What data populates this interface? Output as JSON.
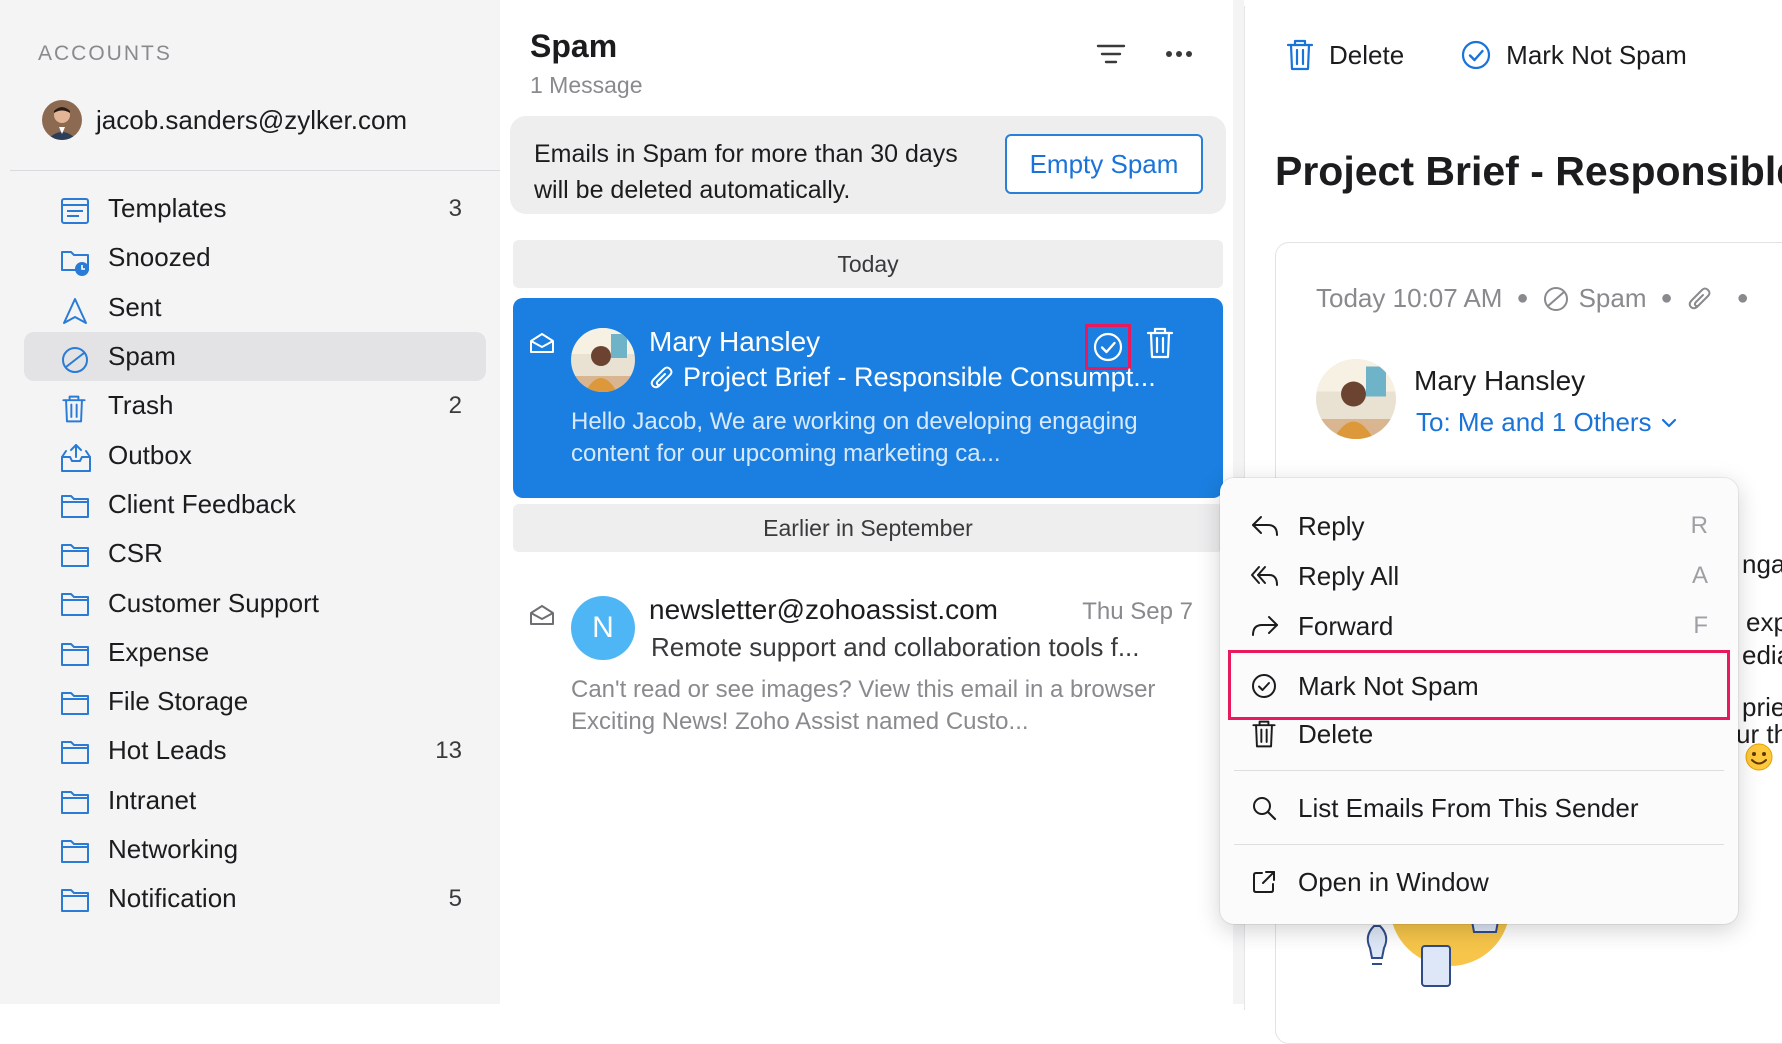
{
  "sidebar": {
    "heading": "ACCOUNTS",
    "account_email": "jacob.sanders@zylker.com",
    "folders": [
      {
        "label": "Templates",
        "count": "3",
        "icon": "template-icon"
      },
      {
        "label": "Snoozed",
        "count": "",
        "icon": "snooze-icon"
      },
      {
        "label": "Sent",
        "count": "",
        "icon": "sent-icon"
      },
      {
        "label": "Spam",
        "count": "",
        "icon": "spam-icon",
        "active": true
      },
      {
        "label": "Trash",
        "count": "2",
        "icon": "trash-icon"
      },
      {
        "label": "Outbox",
        "count": "",
        "icon": "outbox-icon"
      },
      {
        "label": "Client Feedback",
        "count": "",
        "icon": "folder-icon"
      },
      {
        "label": "CSR",
        "count": "",
        "icon": "folder-icon"
      },
      {
        "label": "Customer Support",
        "count": "",
        "icon": "folder-icon"
      },
      {
        "label": "Expense",
        "count": "",
        "icon": "folder-icon"
      },
      {
        "label": "File Storage",
        "count": "",
        "icon": "folder-icon"
      },
      {
        "label": "Hot Leads",
        "count": "13",
        "icon": "folder-icon"
      },
      {
        "label": "Intranet",
        "count": "",
        "icon": "folder-icon"
      },
      {
        "label": "Networking",
        "count": "",
        "icon": "folder-icon"
      },
      {
        "label": "Notification",
        "count": "5",
        "icon": "folder-icon"
      }
    ]
  },
  "list": {
    "title": "Spam",
    "count": "1 Message",
    "notice": "Emails in Spam for more than 30 days will be deleted automatically.",
    "empty_button": "Empty Spam",
    "group_today": "Today",
    "group_earlier": "Earlier in September",
    "selected_mail": {
      "sender": "Mary Hansley",
      "subject": "Project Brief - Responsible Consumpt...",
      "preview": "Hello Jacob, We are working on developing engaging content for our upcoming marketing ca..."
    },
    "second_mail": {
      "avatar_letter": "N",
      "sender": "newsletter@zohoassist.com",
      "date": "Thu Sep 7",
      "subject": "Remote support and collaboration tools f...",
      "preview": "Can't read or see images? View this email in a browser Exciting News! Zoho Assist named Custo..."
    }
  },
  "reader": {
    "toolbar_delete": "Delete",
    "toolbar_not_spam": "Mark Not Spam",
    "subject": "Project Brief - Responsible C",
    "time": "Today 10:07 AM",
    "folder": "Spam",
    "from": "Mary Hansley",
    "to": "To: Me and 1 Others",
    "peek": [
      "nga",
      "exp",
      "edia",
      "prie",
      "ur th"
    ]
  },
  "menu": {
    "reply": "Reply",
    "reply_key": "R",
    "reply_all": "Reply All",
    "reply_all_key": "A",
    "forward": "Forward",
    "forward_key": "F",
    "not_spam": "Mark Not Spam",
    "delete": "Delete",
    "list_sender": "List Emails From This Sender",
    "open_window": "Open in Window"
  },
  "colors": {
    "accent": "#1a7fe0",
    "highlight": "#e8195d",
    "sidebar_bg": "#f4f4f5"
  }
}
